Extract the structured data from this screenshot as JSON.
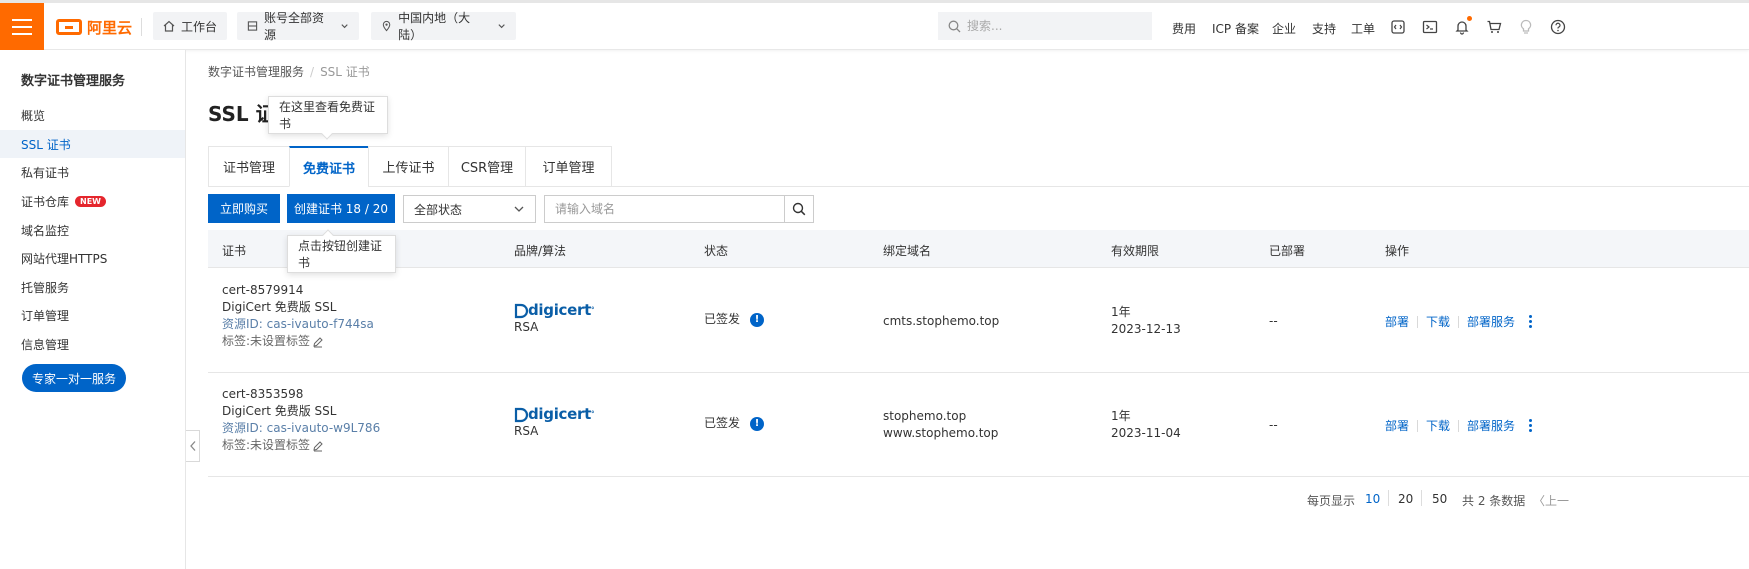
{
  "topbar": {
    "logo": "阿里云",
    "workbench": "工作台",
    "account_resources": "账号全部资源",
    "region": "中国内地（大陆）",
    "search_placeholder": "搜索...",
    "links": [
      "费用",
      "ICP 备案",
      "企业",
      "支持",
      "工单"
    ],
    "accent_color": "#ff6a00"
  },
  "sidebar": {
    "title": "数字证书管理服务",
    "items": [
      {
        "label": "概览"
      },
      {
        "label": "SSL 证书"
      },
      {
        "label": "私有证书"
      },
      {
        "label": "证书仓库",
        "badge": "NEW"
      },
      {
        "label": "域名监控"
      },
      {
        "label": "网站代理HTTPS"
      },
      {
        "label": "托管服务"
      },
      {
        "label": "订单管理"
      },
      {
        "label": "信息管理"
      }
    ],
    "expert_button": "专家一对一服务"
  },
  "breadcrumb": {
    "root": "数字证书管理服务",
    "current": "SSL 证书"
  },
  "page_title": "SSL 证",
  "tooltips": {
    "free_cert": "在这里查看免费证书",
    "create_cert": "点击按钮创建证书"
  },
  "tabs": [
    "证书管理",
    "免费证书",
    "上传证书",
    "CSR管理",
    "订单管理"
  ],
  "toolbar": {
    "buy_now": "立即购买",
    "create_cert": "创建证书 18 / 20",
    "status_select": "全部状态",
    "domain_placeholder": "请输入域名"
  },
  "table": {
    "columns": [
      "证书",
      "品牌/算法",
      "状态",
      "绑定域名",
      "有效期限",
      "已部署",
      "操作"
    ],
    "rows": [
      {
        "cert_id": "cert-8579914",
        "cert_name": "DigiCert 免费版 SSL",
        "resource_id": "资源ID: cas-ivauto-f744sa",
        "tag": "标签:未设置标签",
        "brand": "digicert",
        "algorithm": "RSA",
        "status": "已签发",
        "domains": [
          "cmts.stophemo.top"
        ],
        "validity": "1年",
        "expiry": "2023-12-13",
        "deployed": "--",
        "actions": [
          "部署",
          "下载",
          "部署服务"
        ]
      },
      {
        "cert_id": "cert-8353598",
        "cert_name": "DigiCert 免费版 SSL",
        "resource_id": "资源ID: cas-ivauto-w9L786",
        "tag": "标签:未设置标签",
        "brand": "digicert",
        "algorithm": "RSA",
        "status": "已签发",
        "domains": [
          "stophemo.top",
          "www.stophemo.top"
        ],
        "validity": "1年",
        "expiry": "2023-11-04",
        "deployed": "--",
        "actions": [
          "部署",
          "下载",
          "部署服务"
        ]
      }
    ]
  },
  "pagination": {
    "per_page_label": "每页显示",
    "sizes": [
      "10",
      "20",
      "50"
    ],
    "total": "共 2 条数据",
    "prev": "〈上一"
  }
}
